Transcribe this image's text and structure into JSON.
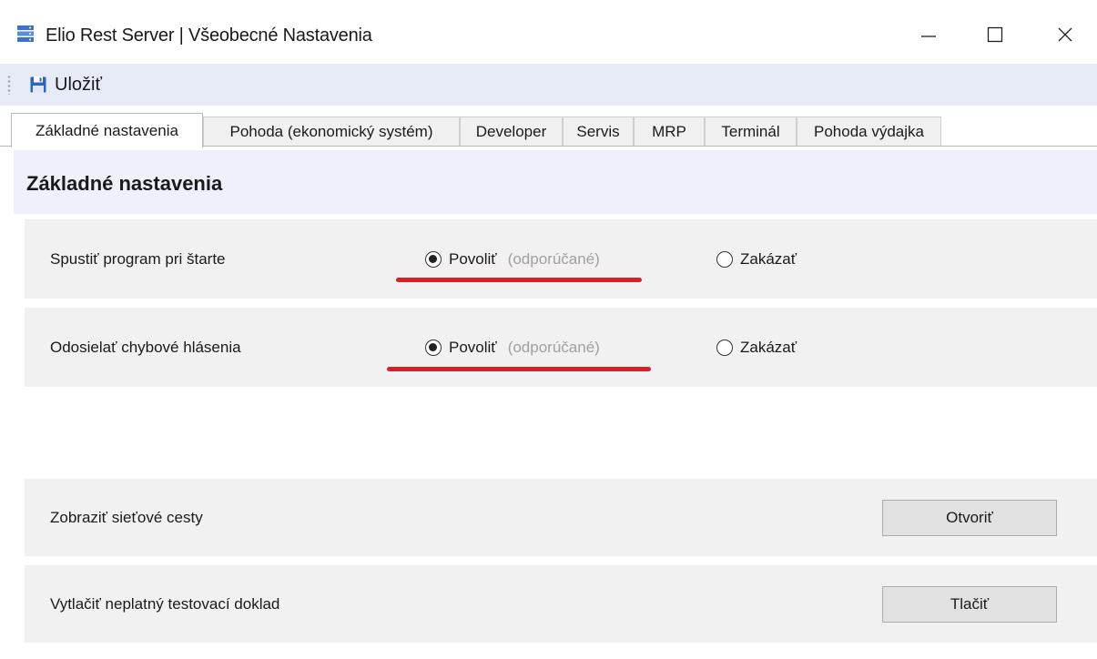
{
  "window": {
    "title": "Elio Rest Server | Všeobecné Nastavenia",
    "icon": "server-icon",
    "controls": [
      "minimize",
      "maximize",
      "close"
    ]
  },
  "toolbar": {
    "save_label": "Uložiť",
    "save_icon": "floppy-disk-icon"
  },
  "tabs": [
    {
      "label": "Základné nastavenia",
      "active": true
    },
    {
      "label": "Pohoda (ekonomický systém)",
      "active": false
    },
    {
      "label": "Developer",
      "active": false
    },
    {
      "label": "Servis",
      "active": false
    },
    {
      "label": "MRP",
      "active": false
    },
    {
      "label": "Terminál",
      "active": false
    },
    {
      "label": "Pohoda výdajka",
      "active": false
    }
  ],
  "section": {
    "title": "Základné nastavenia"
  },
  "settings": [
    {
      "label": "Spustiť program pri štarte",
      "enable_label": "Povoliť",
      "enable_hint": "(odporúčané)",
      "disable_label": "Zakázať",
      "selected": "enable"
    },
    {
      "label": "Odosielať chybové hlásenia",
      "enable_label": "Povoliť",
      "enable_hint": "(odporúčané)",
      "disable_label": "Zakázať",
      "selected": "enable"
    }
  ],
  "actions": [
    {
      "label": "Zobraziť sieťové cesty",
      "button": "Otvoriť"
    },
    {
      "label": "Vytlačiť neplatný testovací doklad",
      "button": "Tlačiť"
    }
  ],
  "colors": {
    "toolbar_bg": "#e6ebf7",
    "section_header_bg": "#eef1fb",
    "row_bg": "#f1f1f1",
    "annotation_red": "#d8202c",
    "hint_gray": "#a0a0a0"
  }
}
